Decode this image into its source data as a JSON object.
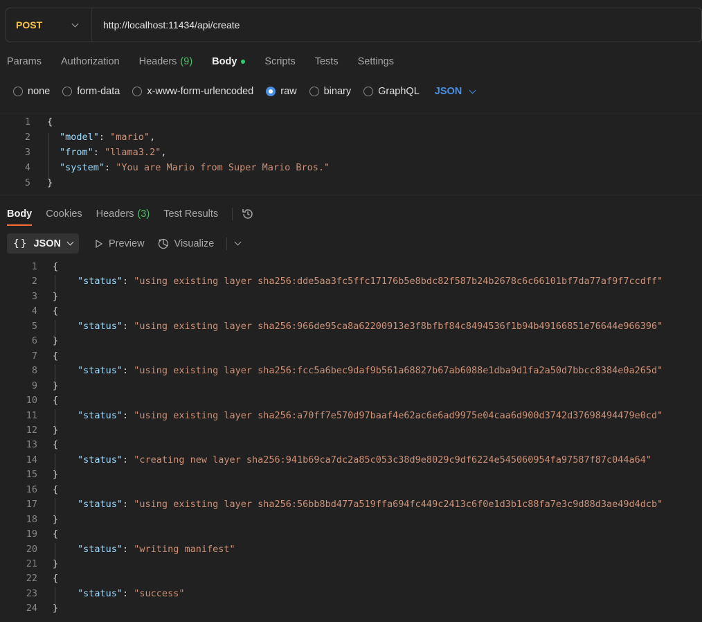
{
  "request": {
    "method": "POST",
    "url": "http://localhost:11434/api/create"
  },
  "request_tabs": [
    {
      "label": "Params"
    },
    {
      "label": "Authorization"
    },
    {
      "label": "Headers",
      "count": "(9)"
    },
    {
      "label": "Body",
      "active": true
    },
    {
      "label": "Scripts"
    },
    {
      "label": "Tests"
    },
    {
      "label": "Settings"
    }
  ],
  "body_types": {
    "options": [
      "none",
      "form-data",
      "x-www-form-urlencoded",
      "raw",
      "binary",
      "GraphQL"
    ],
    "selected": "raw",
    "format": "JSON"
  },
  "request_body": {
    "line_numbers": [
      "1",
      "2",
      "3",
      "4",
      "5"
    ],
    "open": "{",
    "close": "}",
    "fields": [
      {
        "key": "\"model\"",
        "value": "\"mario\"",
        "trail": ","
      },
      {
        "key": "\"from\"",
        "value": "\"llama3.2\"",
        "trail": ","
      },
      {
        "key": "\"system\"",
        "value": "\"You are Mario from Super Mario Bros.\"",
        "trail": ""
      }
    ]
  },
  "response_tabs": {
    "body": "Body",
    "cookies": "Cookies",
    "headers": "Headers",
    "headers_count": "(3)",
    "test_results": "Test Results"
  },
  "response_toolbar": {
    "format": "JSON",
    "preview": "Preview",
    "visualize": "Visualize"
  },
  "response_body": {
    "key": "\"status\"",
    "open": "{",
    "close": "}",
    "entries": [
      "\"using existing layer sha256:dde5aa3fc5ffc17176b5e8bdc82f587b24b2678c6c66101bf7da77af9f7ccdff\"",
      "\"using existing layer sha256:966de95ca8a62200913e3f8bfbf84c8494536f1b94b49166851e76644e966396\"",
      "\"using existing layer sha256:fcc5a6bec9daf9b561a68827b67ab6088e1dba9d1fa2a50d7bbcc8384e0a265d\"",
      "\"using existing layer sha256:a70ff7e570d97baaf4e62ac6e6ad9975e04caa6d900d3742d37698494479e0cd\"",
      "\"creating new layer sha256:941b69ca7dc2a85c053c38d9e8029c9df6224e545060954fa97587f87c044a64\"",
      "\"using existing layer sha256:56bb8bd477a519ffa694fc449c2413c6f0e1d3b1c88fa7e3c9d88d3ae49d4dcb\"",
      "\"writing manifest\"",
      "\"success\""
    ],
    "line_numbers": [
      "1",
      "2",
      "3",
      "4",
      "5",
      "6",
      "7",
      "8",
      "9",
      "10",
      "11",
      "12",
      "13",
      "14",
      "15",
      "16",
      "17",
      "18",
      "19",
      "20",
      "21",
      "22",
      "23",
      "24"
    ]
  }
}
